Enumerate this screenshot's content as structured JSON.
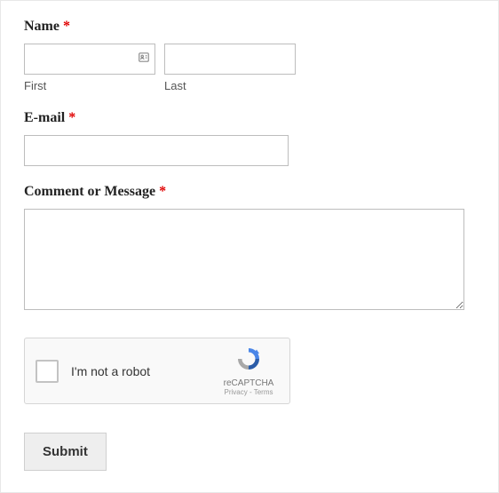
{
  "fields": {
    "name": {
      "label": "Name",
      "required": "*",
      "first_sub": "First",
      "last_sub": "Last"
    },
    "email": {
      "label": "E-mail",
      "required": "*"
    },
    "comment": {
      "label": "Comment or Message",
      "required": "*"
    }
  },
  "captcha": {
    "label": "I'm not a robot",
    "brand": "reCAPTCHA",
    "links": "Privacy - Terms"
  },
  "submit": {
    "label": "Submit"
  }
}
